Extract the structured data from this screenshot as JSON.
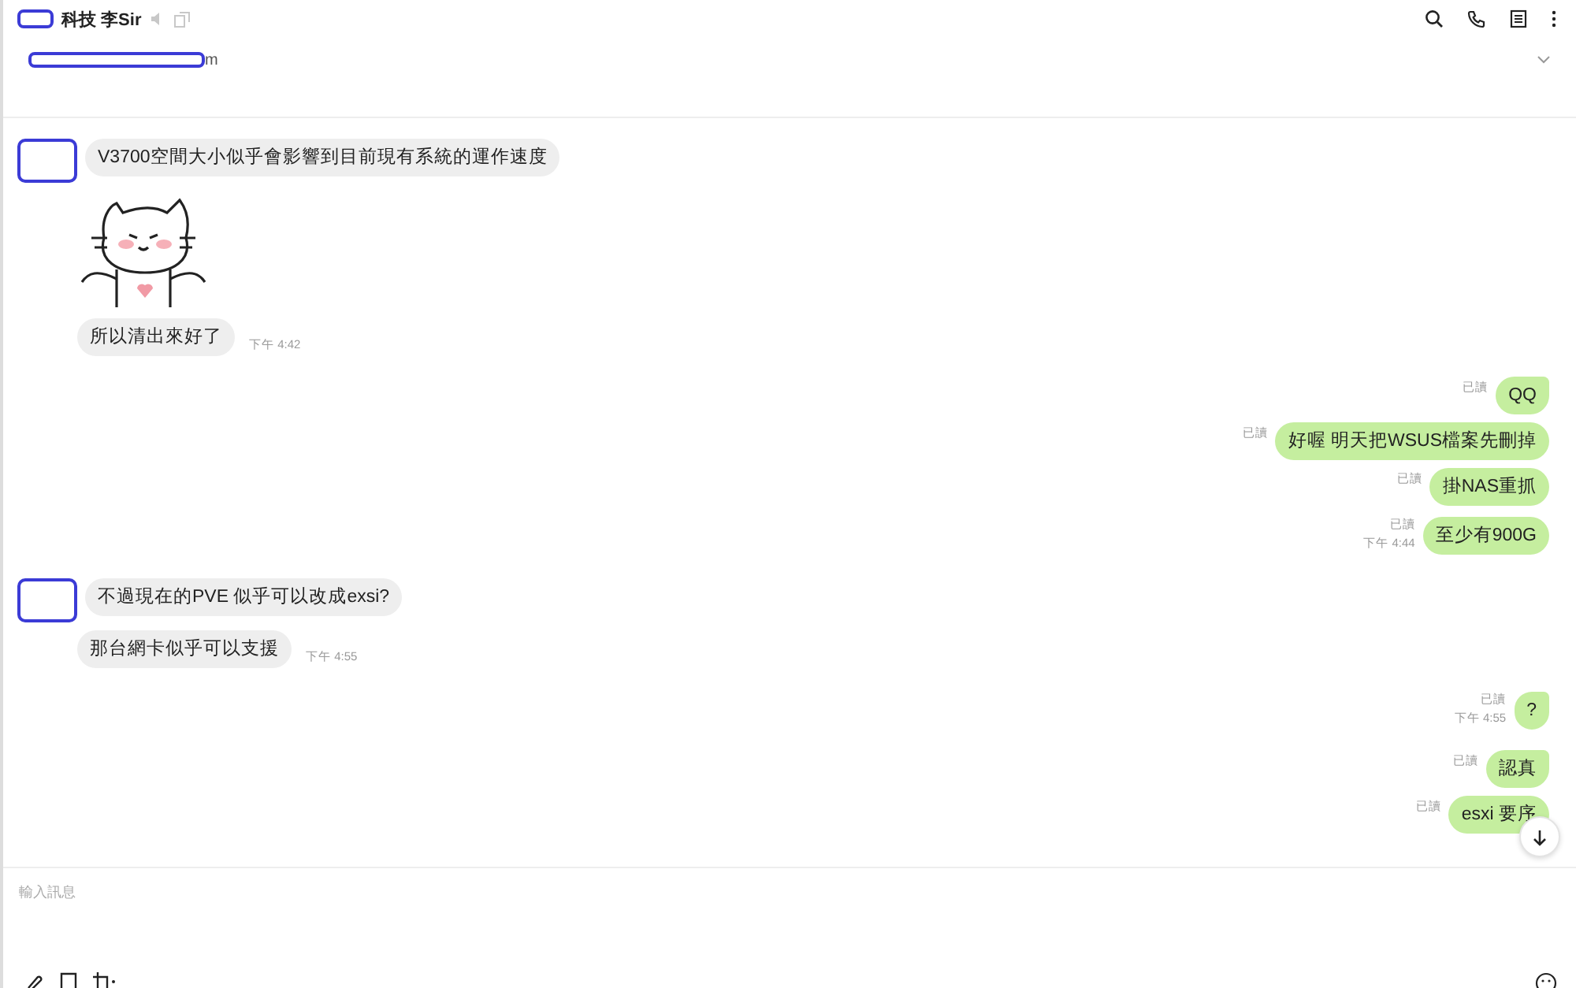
{
  "header": {
    "title": "科技 李Sir",
    "subtitle": "m"
  },
  "messages": [
    {
      "kind": "incoming-text",
      "avatar": true,
      "text": "V3700空間大小似乎會影響到目前現有系統的運作速度"
    },
    {
      "kind": "incoming-sticker",
      "avatar": false
    },
    {
      "kind": "incoming-text",
      "avatar": false,
      "text": "所以清出來好了",
      "time": "下午 4:42"
    },
    {
      "kind": "outgoing-text",
      "tail": true,
      "read": "已讀",
      "text": "QQ"
    },
    {
      "kind": "outgoing-text",
      "tail": false,
      "read": "已讀",
      "text": "好喔 明天把WSUS檔案先刪掉"
    },
    {
      "kind": "outgoing-text",
      "tail": false,
      "read": "已讀",
      "text": "掛NAS重抓"
    },
    {
      "kind": "outgoing-text",
      "tail": false,
      "read": "已讀",
      "time": "下午 4:44",
      "text": "至少有900G"
    },
    {
      "kind": "incoming-text",
      "avatar": true,
      "text": "不過現在的PVE 似乎可以改成exsi?"
    },
    {
      "kind": "incoming-text",
      "avatar": false,
      "text": "那台網卡似乎可以支援",
      "time": "下午 4:55"
    },
    {
      "kind": "outgoing-text",
      "tail": true,
      "read": "已讀",
      "time": "下午 4:55",
      "text": "?"
    },
    {
      "kind": "outgoing-text",
      "tail": true,
      "read": "已讀",
      "text": "認真"
    },
    {
      "kind": "outgoing-text",
      "tail": false,
      "read": "已讀",
      "text": "esxi 要序"
    }
  ],
  "composer": {
    "placeholder": "輸入訊息"
  }
}
